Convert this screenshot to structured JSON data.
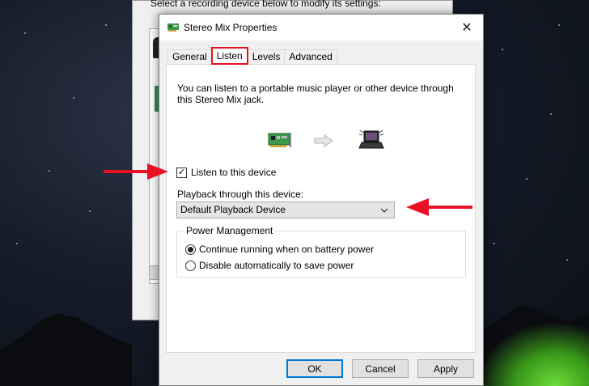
{
  "back_window": {
    "hint_text": "Select a recording device below to modify its settings:"
  },
  "dialog": {
    "title": "Stereo Mix Properties",
    "close_glyph": "✕",
    "tabs": [
      {
        "label": "General",
        "active": false
      },
      {
        "label": "Listen",
        "active": true
      },
      {
        "label": "Levels",
        "active": false
      },
      {
        "label": "Advanced",
        "active": false
      }
    ],
    "description": "You can listen to a portable music player or other device through this Stereo Mix jack.",
    "listen_checkbox": {
      "label": "Listen to this device",
      "checked": true
    },
    "playback": {
      "label": "Playback through this device:",
      "selected": "Default Playback Device"
    },
    "power_management": {
      "title": "Power Management",
      "options": [
        {
          "label": "Continue running when on battery power",
          "selected": true
        },
        {
          "label": "Disable automatically to save power",
          "selected": false
        }
      ]
    },
    "buttons": {
      "ok": "OK",
      "cancel": "Cancel",
      "apply": "Apply"
    }
  },
  "icons": {
    "title": "sound-card-icon",
    "card": "sound-card-icon",
    "arrow": "arrow-right-icon",
    "laptop": "laptop-speaker-icon",
    "dropdown": "chevron-down-icon"
  },
  "colors": {
    "highlight": "#e81123",
    "default_button_border": "#0078d7",
    "annotation_arrow": "#e81123"
  }
}
